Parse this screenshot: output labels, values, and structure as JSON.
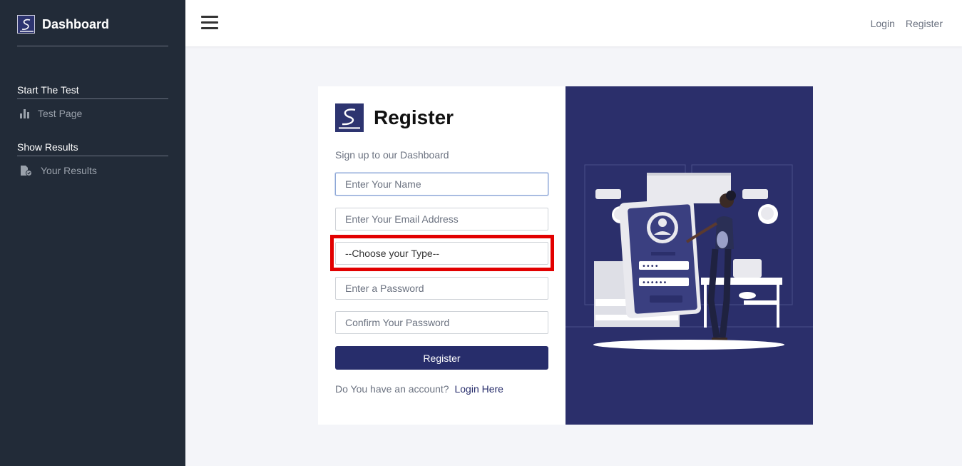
{
  "app": {
    "title": "Dashboard",
    "brand_color": "#222b38",
    "accent_color": "#272d6b"
  },
  "sidebar": {
    "sections": [
      {
        "title": "Start The Test",
        "item": {
          "label": "Test Page",
          "icon": "bar-chart-icon"
        }
      },
      {
        "title": "Show Results",
        "item": {
          "label": "Your Results",
          "icon": "file-check-icon"
        }
      }
    ]
  },
  "topbar": {
    "menu_icon": "hamburger-icon",
    "links": [
      "Login",
      "Register"
    ]
  },
  "form": {
    "title": "Register",
    "subtitle": "Sign up to our Dashboard",
    "name_placeholder": "Enter Your Name",
    "email_placeholder": "Enter Your Email Address",
    "type_selected": "--Choose your Type--",
    "password_placeholder": "Enter a Password",
    "confirm_placeholder": "Confirm Your Password",
    "submit_label": "Register",
    "account_prompt": "Do You have an account?",
    "login_link": "Login Here"
  },
  "illustration": {
    "description_icon": "user-login-illustration",
    "pin_mask": "••••",
    "password_mask": "••••••"
  }
}
